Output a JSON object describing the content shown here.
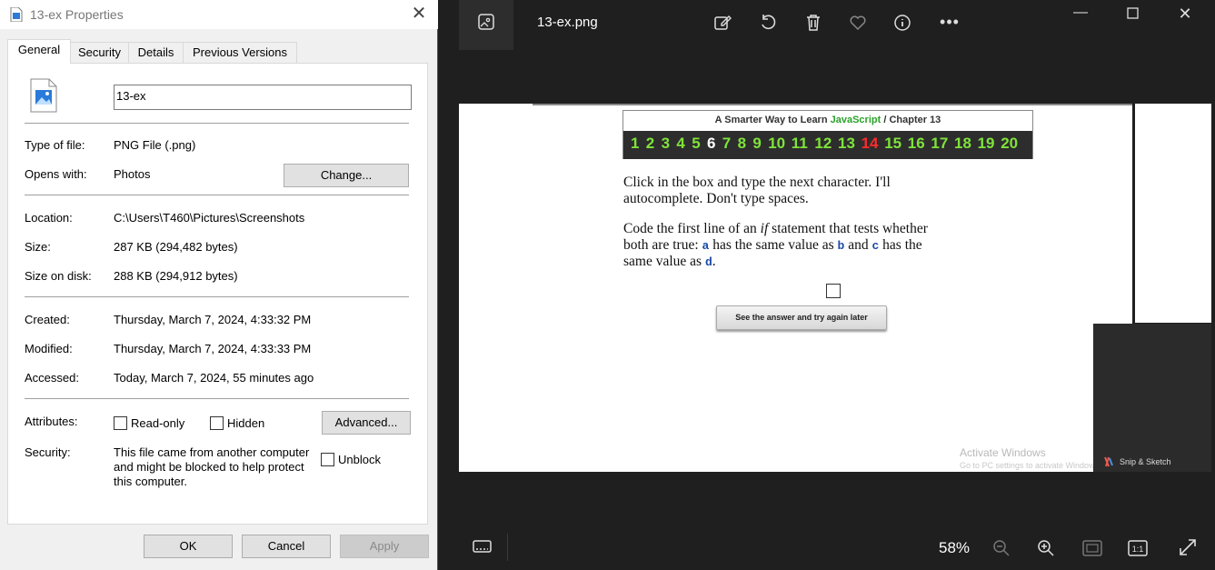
{
  "dialog": {
    "title": "13-ex Properties",
    "tabs": [
      "General",
      "Security",
      "Details",
      "Previous Versions"
    ],
    "file_name": "13-ex",
    "rows": {
      "type_label": "Type of file:",
      "type_value": "PNG File (.png)",
      "opens_label": "Opens with:",
      "opens_value": "Photos",
      "change_label": "Change...",
      "location_label": "Location:",
      "location_value": "C:\\Users\\T460\\Pictures\\Screenshots",
      "size_label": "Size:",
      "size_value": "287 KB (294,482 bytes)",
      "disk_label": "Size on disk:",
      "disk_value": "288 KB (294,912 bytes)",
      "created_label": "Created:",
      "created_value": "Thursday, March 7, 2024, 4:33:32 PM",
      "modified_label": "Modified:",
      "modified_value": "Thursday, March 7, 2024, 4:33:33 PM",
      "accessed_label": "Accessed:",
      "accessed_value": "Today, March 7, 2024, 55 minutes ago",
      "attributes_label": "Attributes:",
      "readonly_label": "Read-only",
      "hidden_label": "Hidden",
      "advanced_label": "Advanced...",
      "security_label": "Security:",
      "security_l1": "This file came from another computer",
      "security_l2": "and might be blocked to help protect",
      "security_l3": "this computer.",
      "unblock_label": "Unblock"
    },
    "buttons": {
      "ok": "OK",
      "cancel": "Cancel",
      "apply": "Apply"
    }
  },
  "viewer": {
    "filename": "13-ex.png",
    "zoom": "58%",
    "icons": [
      "image-icon",
      "edit-icon",
      "rotate-icon",
      "delete-icon",
      "favorite-icon",
      "info-icon",
      "more-icon",
      "minimize-icon",
      "maximize-icon",
      "close-icon",
      "filmstrip-icon",
      "zoom-out-icon",
      "zoom-in-icon",
      "fit-icon",
      "actual-size-icon",
      "fullscreen-icon"
    ],
    "content": {
      "header_a": "A Smarter Way to Learn ",
      "header_js": "JavaScript",
      "header_b": "  /  Chapter 13",
      "numbers": [
        "1",
        "2",
        "3",
        "4",
        "5",
        "6",
        "7",
        "8",
        "9",
        "10",
        "11",
        "12",
        "13",
        "14",
        "15",
        "16",
        "17",
        "18",
        "19",
        "20"
      ],
      "current": "6",
      "highlight": "14",
      "p1_l1": "Click in the box and type the next character. I'll",
      "p1_l2": "autocomplete. Don't type spaces.",
      "p2_l1a": "Code the first line of an ",
      "p2_l1_if": "if",
      "p2_l1b": " statement that tests whether",
      "p2_l2a": "both are true: ",
      "var_a": "a",
      "p2_l2b": " has the same value as ",
      "var_b": "b",
      "p2_l2c": " and ",
      "var_c": "c",
      "p2_l2d": " has the",
      "p2_l3a": "same value as ",
      "var_d": "d",
      "p2_l3b": ".",
      "answer_button": "See the answer and try again later",
      "activate_1": "Activate Windows",
      "activate_2": "Go to PC settings to activate Windows."
    },
    "snip_label": "Snip & Sketch"
  },
  "colors": {
    "js_green": "#2aa12a",
    "number_green": "#7fe33a",
    "highlight_red": "#ff2a2a"
  }
}
